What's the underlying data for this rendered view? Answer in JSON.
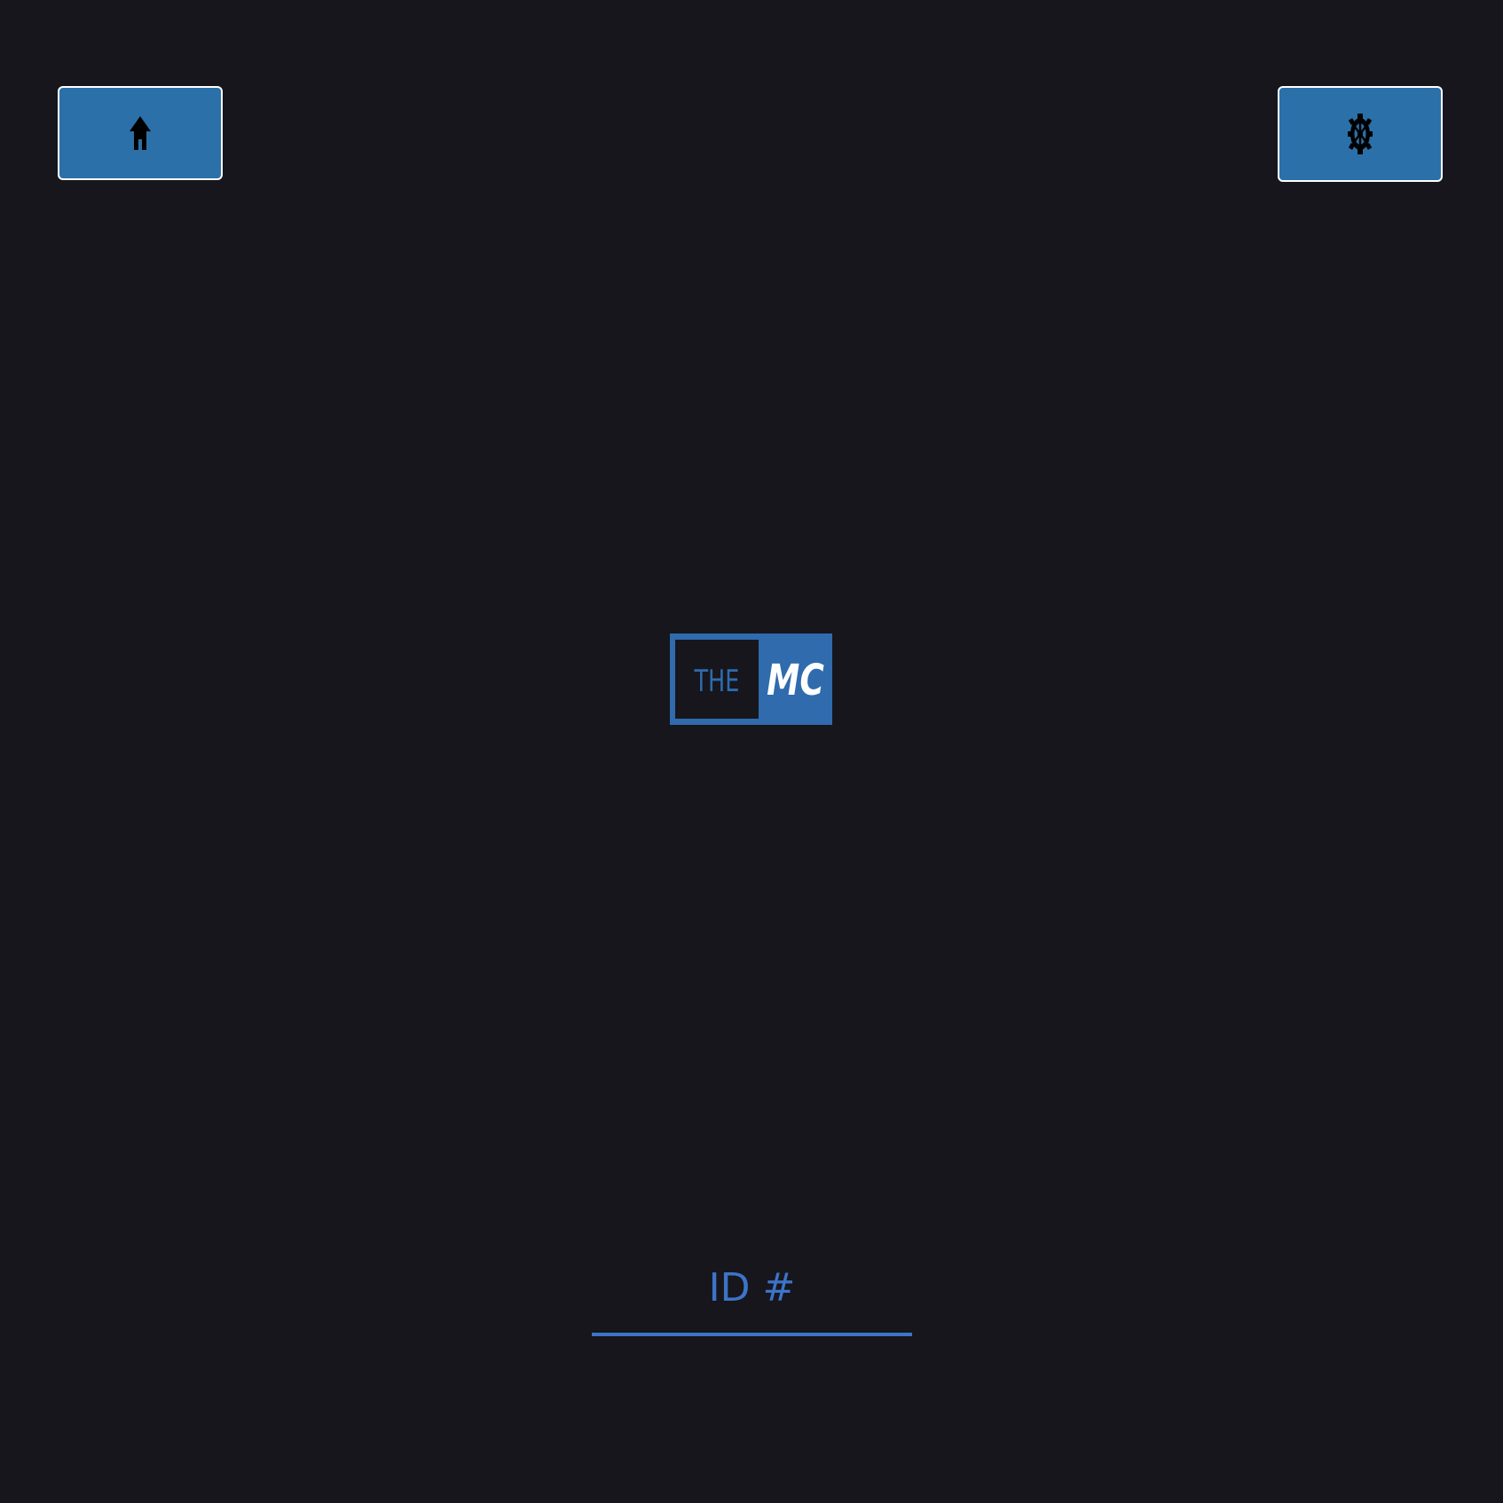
{
  "toolbar": {
    "home_button": {
      "icon": "home-icon"
    },
    "settings_button": {
      "icon": "gear-icon"
    }
  },
  "logo": {
    "left_text": "THE",
    "right_text": "MC",
    "brand_color": "#2f6bad"
  },
  "id_input": {
    "placeholder": "ID #",
    "value": ""
  },
  "colors": {
    "background": "#17161d",
    "button_fill": "#2b70a8",
    "accent": "#3c74c8"
  }
}
